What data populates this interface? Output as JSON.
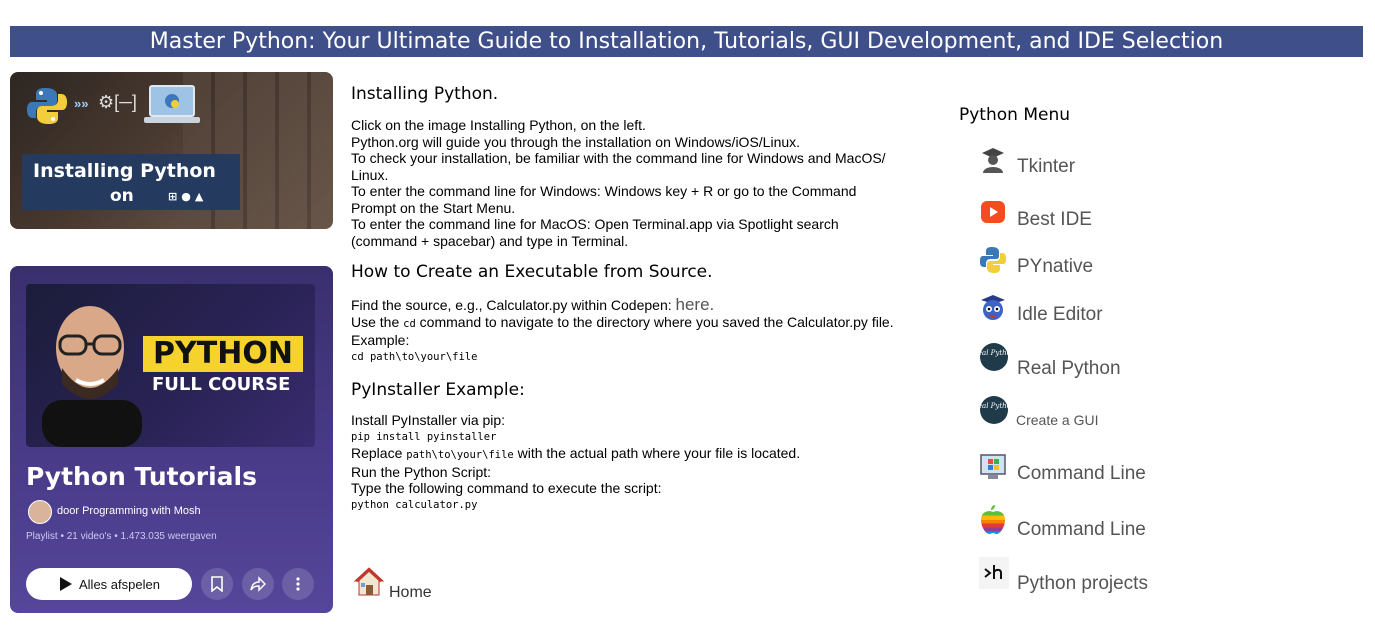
{
  "banner": {
    "title": "Master Python: Your Ultimate Guide to Installation, Tutorials, GUI Development, and IDE Selection"
  },
  "thumb_install": {
    "caption_line1": "Installing Python",
    "caption_line2": "on",
    "gear_text": "⚙[─]"
  },
  "thumb_playlist": {
    "badge": "PYTHON",
    "subtitle": "FULL COURSE",
    "title": "Python Tutorials",
    "author": "door Programming with Mosh",
    "meta": "Playlist • 21 video's • 1.473.035 weergaven",
    "play_all": "Alles afspelen"
  },
  "section1": {
    "heading": "Installing Python.",
    "lines": [
      "Click on the image Installing Python, on the left.",
      "Python.org will guide you through the installation on Windows/iOS/Linux.",
      "To check your installation, be familiar with the command line for Windows and MacOS/",
      "Linux.",
      "To enter the command line for Windows: Windows key + R or go to the Command",
      "Prompt on the Start Menu.",
      "To enter the command line for MacOS: Open Terminal.app via Spotlight search",
      "(command + spacebar) and type in Terminal."
    ]
  },
  "section2": {
    "heading": "How to Create an Executable from Source.",
    "find_text": "Find the source, e.g., Calculator.py within Codepen: ",
    "here_link": "here.",
    "use_pre": "Use the ",
    "use_code": "cd",
    "use_post": " command to navigate to the directory where you saved the Calculator.py file.",
    "example": "Example:",
    "example_code": "cd path\\to\\your\\file"
  },
  "section3": {
    "heading": "PyInstaller Example:",
    "install_text": "Install PyInstaller via pip:",
    "install_code": "pip install pyinstaller",
    "replace_pre": "Replace ",
    "replace_code": "path\\to\\your\\file",
    "replace_post": " with the actual path where your file is located.",
    "run_text": "Run the Python Script:",
    "type_text": "Type the following command to execute the script:",
    "run_code": "python calculator.py"
  },
  "home": {
    "label": "Home"
  },
  "menu": {
    "title": "Python Menu",
    "items": [
      {
        "label": "Tkinter",
        "icon": "graduate-icon"
      },
      {
        "label": "Best IDE",
        "icon": "youtube-icon"
      },
      {
        "label": "PYnative",
        "icon": "python-icon"
      },
      {
        "label": "Idle Editor",
        "icon": "mascot-icon"
      },
      {
        "label": "Real Python",
        "icon": "realpython-icon"
      },
      {
        "label": "Create a GUI",
        "icon": "realpython-icon"
      },
      {
        "label": "Command Line",
        "icon": "windows-icon"
      },
      {
        "label": "Command Line",
        "icon": "apple-icon"
      },
      {
        "label": "Python projects",
        "icon": "terminal-icon"
      }
    ],
    "realpython_icon_text": "Real Python"
  },
  "colors": {
    "banner_bg": "#3f4f8a",
    "playlist_bg": "#4a3c8a",
    "badge_yellow": "#f6d22c"
  }
}
